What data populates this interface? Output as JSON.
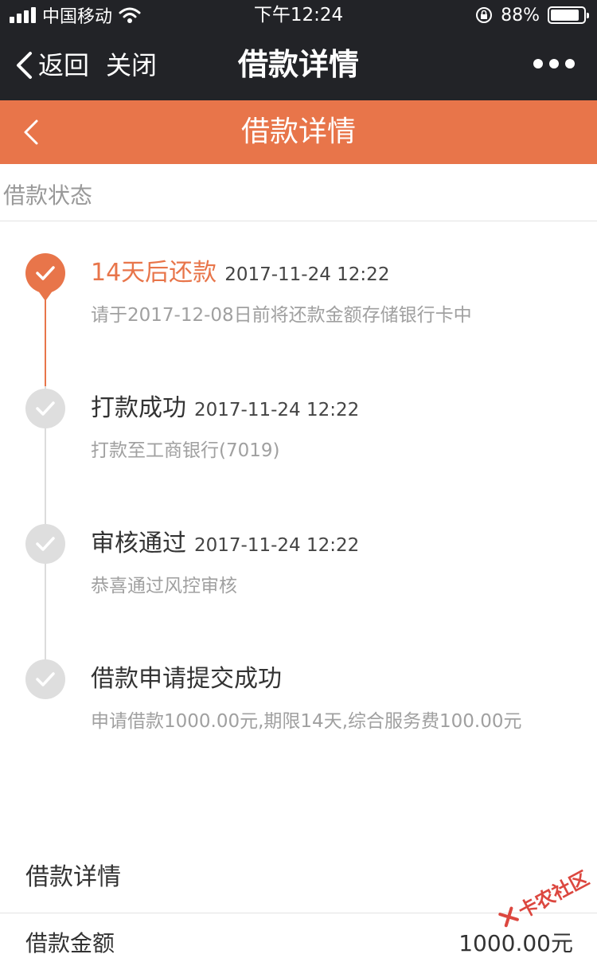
{
  "status_bar": {
    "carrier": "中国移动",
    "time": "下午12:24",
    "battery": "88%",
    "battery_level": 0.88
  },
  "nav": {
    "back_label": "返回",
    "close_label": "关闭",
    "title": "借款详情"
  },
  "header": {
    "title": "借款详情"
  },
  "status_section": {
    "title": "借款状态"
  },
  "timeline": [
    {
      "label": "14天后还款",
      "time": "2017-11-24 12:22",
      "desc": "请于2017-12-08日前将还款金额存储银行卡中"
    },
    {
      "label": "打款成功",
      "time": "2017-11-24 12:22",
      "desc": "打款至工商银行(7019)"
    },
    {
      "label": "审核通过",
      "time": "2017-11-24 12:22",
      "desc": "恭喜通过风控审核"
    },
    {
      "label": "借款申请提交成功",
      "time": "",
      "desc": "申请借款1000.00元,期限14天,综合服务费100.00元"
    }
  ],
  "detail": {
    "title": "借款详情",
    "amount_label": "借款金额",
    "amount_value": "1000.00元"
  },
  "watermark": {
    "text": "卡农社区"
  },
  "colors": {
    "accent": "#e8754a",
    "dark_bar": "#222327",
    "muted_text": "#a0a0a0"
  }
}
